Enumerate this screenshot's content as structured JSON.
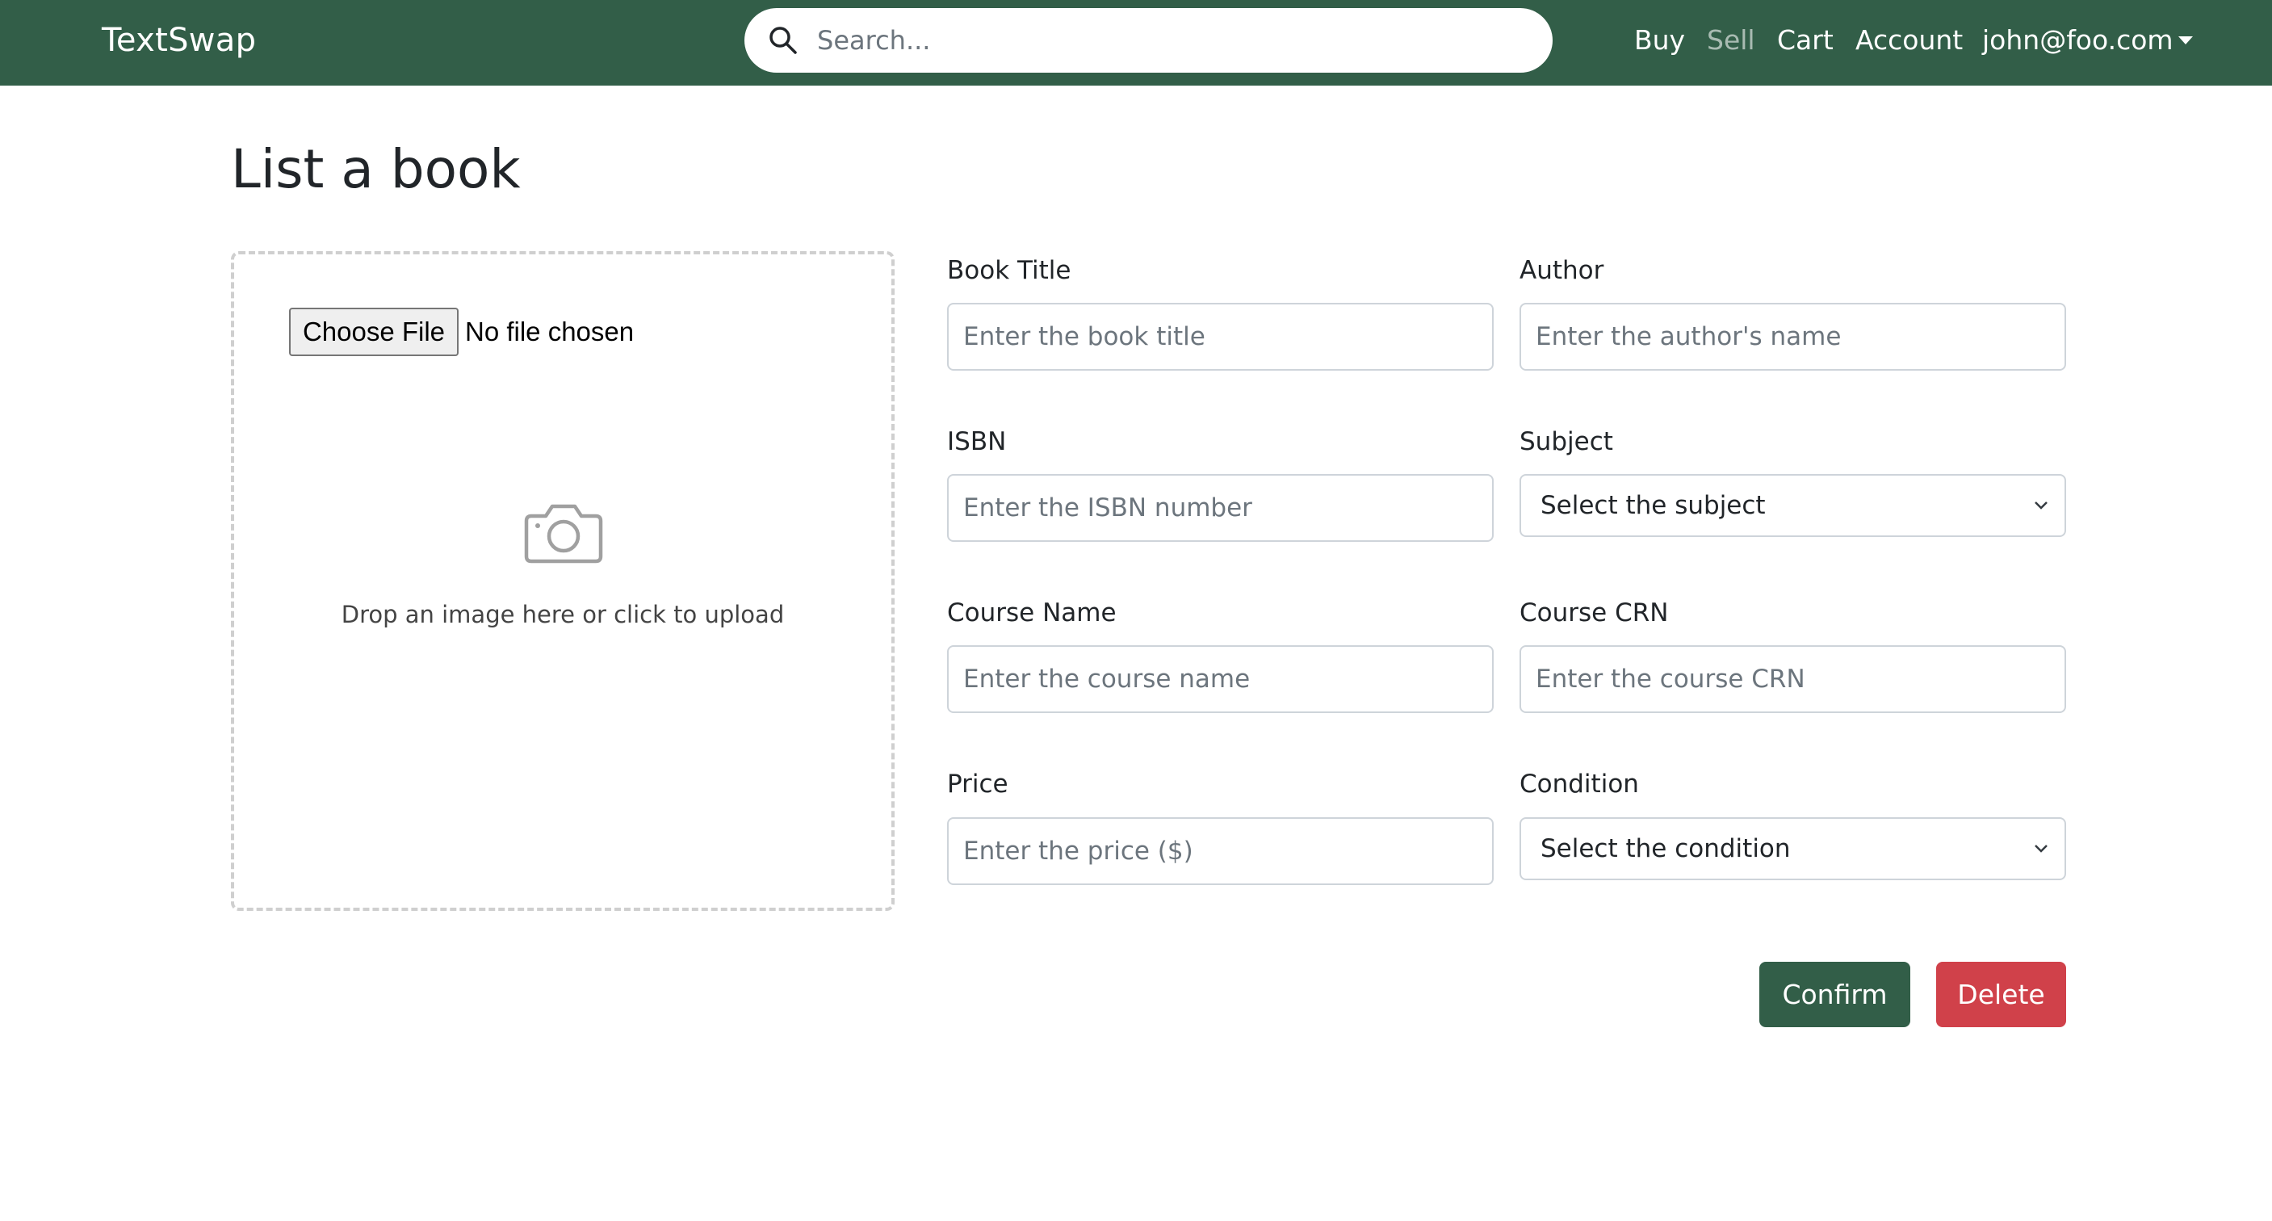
{
  "navbar": {
    "brand": "TextSwap",
    "search_placeholder": "Search...",
    "links": {
      "buy": "Buy",
      "sell": "Sell",
      "cart": "Cart",
      "account": "Account",
      "user": "john@foo.com"
    },
    "background_color": "#325e48"
  },
  "page": {
    "title": "List a book"
  },
  "upload": {
    "button_label": "Choose File",
    "status": "No file chosen",
    "hint": "Drop an image here or click to upload",
    "icon": "camera-icon"
  },
  "form": {
    "book_title": {
      "label": "Book Title",
      "placeholder": "Enter the book title"
    },
    "author": {
      "label": "Author",
      "placeholder": "Enter the author's name"
    },
    "isbn": {
      "label": "ISBN",
      "placeholder": "Enter the ISBN number"
    },
    "subject": {
      "label": "Subject",
      "selected": "Select the subject"
    },
    "course_name": {
      "label": "Course Name",
      "placeholder": "Enter the course name"
    },
    "course_crn": {
      "label": "Course CRN",
      "placeholder": "Enter the course CRN"
    },
    "price": {
      "label": "Price",
      "placeholder": "Enter the price ($)"
    },
    "condition": {
      "label": "Condition",
      "selected": "Select the condition"
    }
  },
  "actions": {
    "confirm": "Confirm",
    "delete": "Delete",
    "confirm_color": "#325e48",
    "delete_color": "#d0414a"
  }
}
